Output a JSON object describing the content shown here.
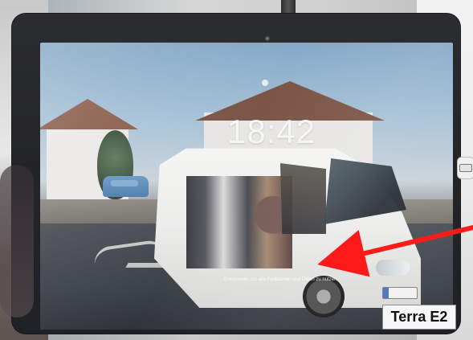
{
  "photo": {
    "clock_time": "18:42",
    "unlock_message": "Entsperren, um alle Funktionen und Daten zu nutzen",
    "sticker_label": "Terra E2"
  },
  "colors": {
    "arrow": "#ff1a1a",
    "sticker_bg": "#f7f7f7",
    "tablet_frame": "#242529"
  },
  "icons": {
    "camera": "camera-lens-icon",
    "status_dot": "status-dot-icon",
    "side_port": "usb-port-icon",
    "arrow": "arrow-pointer-icon"
  }
}
